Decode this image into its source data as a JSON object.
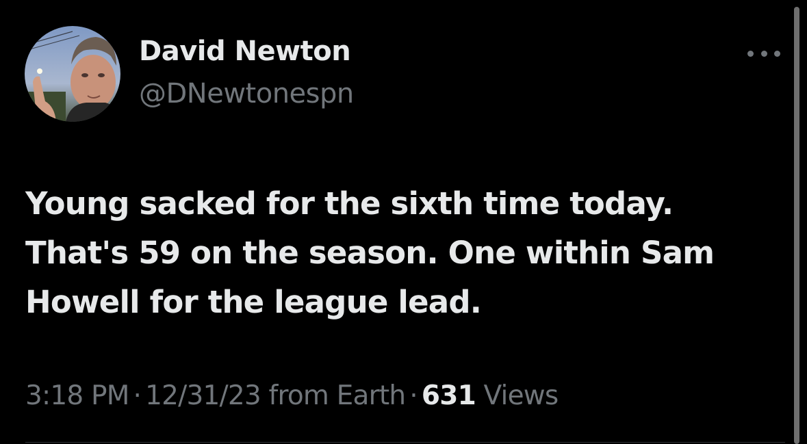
{
  "author": {
    "name": "David Newton",
    "handle": "@DNewtonespn",
    "avatar_icon": "profile-photo"
  },
  "tweet": {
    "text": "Young sacked for the sixth time today. That's 59 on the season. One within Sam Howell for the league lead.",
    "time": "3:18 PM",
    "date": "12/31/23",
    "source": "from Earth",
    "separator": "·",
    "views_count": "631",
    "views_label": "Views"
  },
  "icons": {
    "more": "more-options-icon"
  },
  "colors": {
    "background": "#000000",
    "primary_text": "#e7e9ea",
    "secondary_text": "#71767b",
    "divider": "#2f3336"
  }
}
